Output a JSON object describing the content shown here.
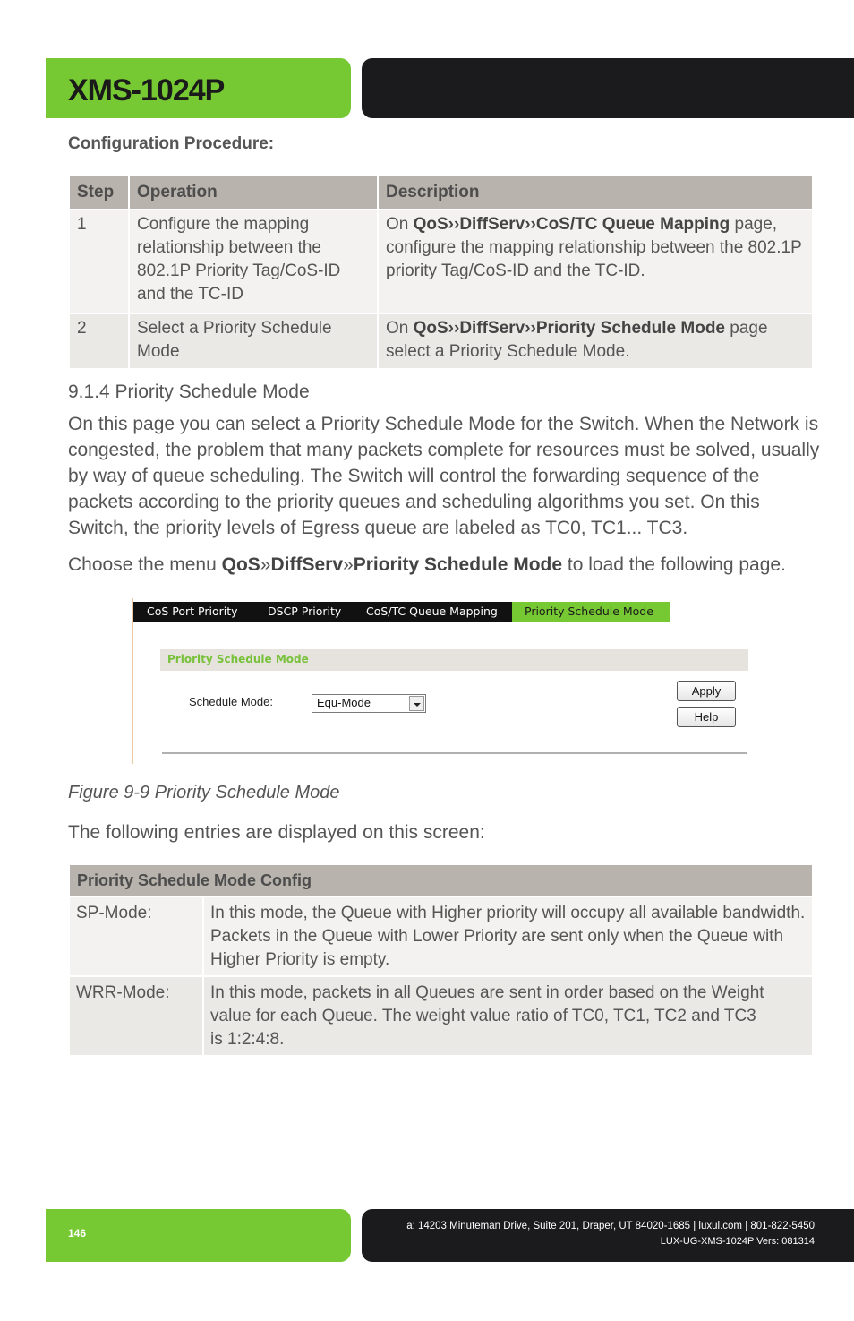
{
  "header": {
    "product_title": "XMS-1024P",
    "accent_color": "#76c933",
    "dark_color": "#1b1a1c"
  },
  "config_procedure": {
    "title": "Configuration Procedure:",
    "columns": [
      "Step",
      "Operation",
      "Description"
    ],
    "rows": [
      {
        "step": "1",
        "operation": "Configure the mapping relationship between the 802.1P Priority Tag/CoS-ID and the TC-ID",
        "desc_prefix": "On ",
        "desc_menu": "QoS››DiffServ››CoS/TC Queue Mapping",
        "desc_suffix": " page, configure the mapping relationship between the 802.1P priority Tag/CoS-ID and the TC-ID."
      },
      {
        "step": "2",
        "operation": "Select a Priority Schedule Mode",
        "desc_prefix": "On ",
        "desc_menu": "QoS››DiffServ››Priority Schedule Mode",
        "desc_suffix": " page select a Priority Schedule Mode."
      }
    ]
  },
  "section": {
    "heading": "9.1.4 Priority Schedule Mode",
    "body": "On this page you can select a Priority Schedule Mode for the Switch. When the Network is congested, the problem that many packets complete for resources must be solved, usually by way of queue scheduling. The Switch will control the forwarding sequence of the packets according to the priority queues and scheduling algorithms you set. On this Switch, the priority levels of Egress queue are labeled as TC0, TC1... TC3.",
    "menu_prefix": "Choose the menu ",
    "menu_part1": "QoS",
    "menu_sep1": "»",
    "menu_part2": "DiffServ",
    "menu_sep2": "»",
    "menu_part3": "Priority Schedule Mode",
    "menu_suffix": " to load the following page."
  },
  "screenshot": {
    "tabs": [
      {
        "label": "CoS Port Priority",
        "active": false
      },
      {
        "label": "DSCP Priority",
        "active": false
      },
      {
        "label": "CoS/TC Queue Mapping",
        "active": false
      },
      {
        "label": "Priority Schedule Mode",
        "active": true
      }
    ],
    "panel_title": "Priority Schedule Mode",
    "schedule_mode_label": "Schedule Mode:",
    "schedule_mode_value": "Equ-Mode",
    "apply_label": "Apply",
    "help_label": "Help"
  },
  "figure_caption": "Figure 9-9 Priority Schedule Mode",
  "entries_intro": "The following entries are displayed on this screen:",
  "config_table": {
    "title": "Priority Schedule Mode Config",
    "rows": [
      {
        "key": "SP-Mode:",
        "value": "In this mode, the Queue with Higher priority will occupy all available bandwidth. Packets in the Queue with Lower Priority are sent only when the Queue with Higher Priority is empty."
      },
      {
        "key": "WRR-Mode:",
        "value_line1": "In this mode, packets in all Queues are sent in order based on the Weight value for each Queue. The weight value ratio of TC0, TC1, TC2 and TC3",
        "value_line2": "is 1:2:4:8."
      }
    ]
  },
  "footer": {
    "page_number": "146",
    "address": "a: 14203 Minuteman Drive, Suite 201, Draper, UT 84020-1685 | luxul.com | 801-822-5450",
    "version": "LUX-UG-XMS-1024P  Vers: 081314"
  }
}
